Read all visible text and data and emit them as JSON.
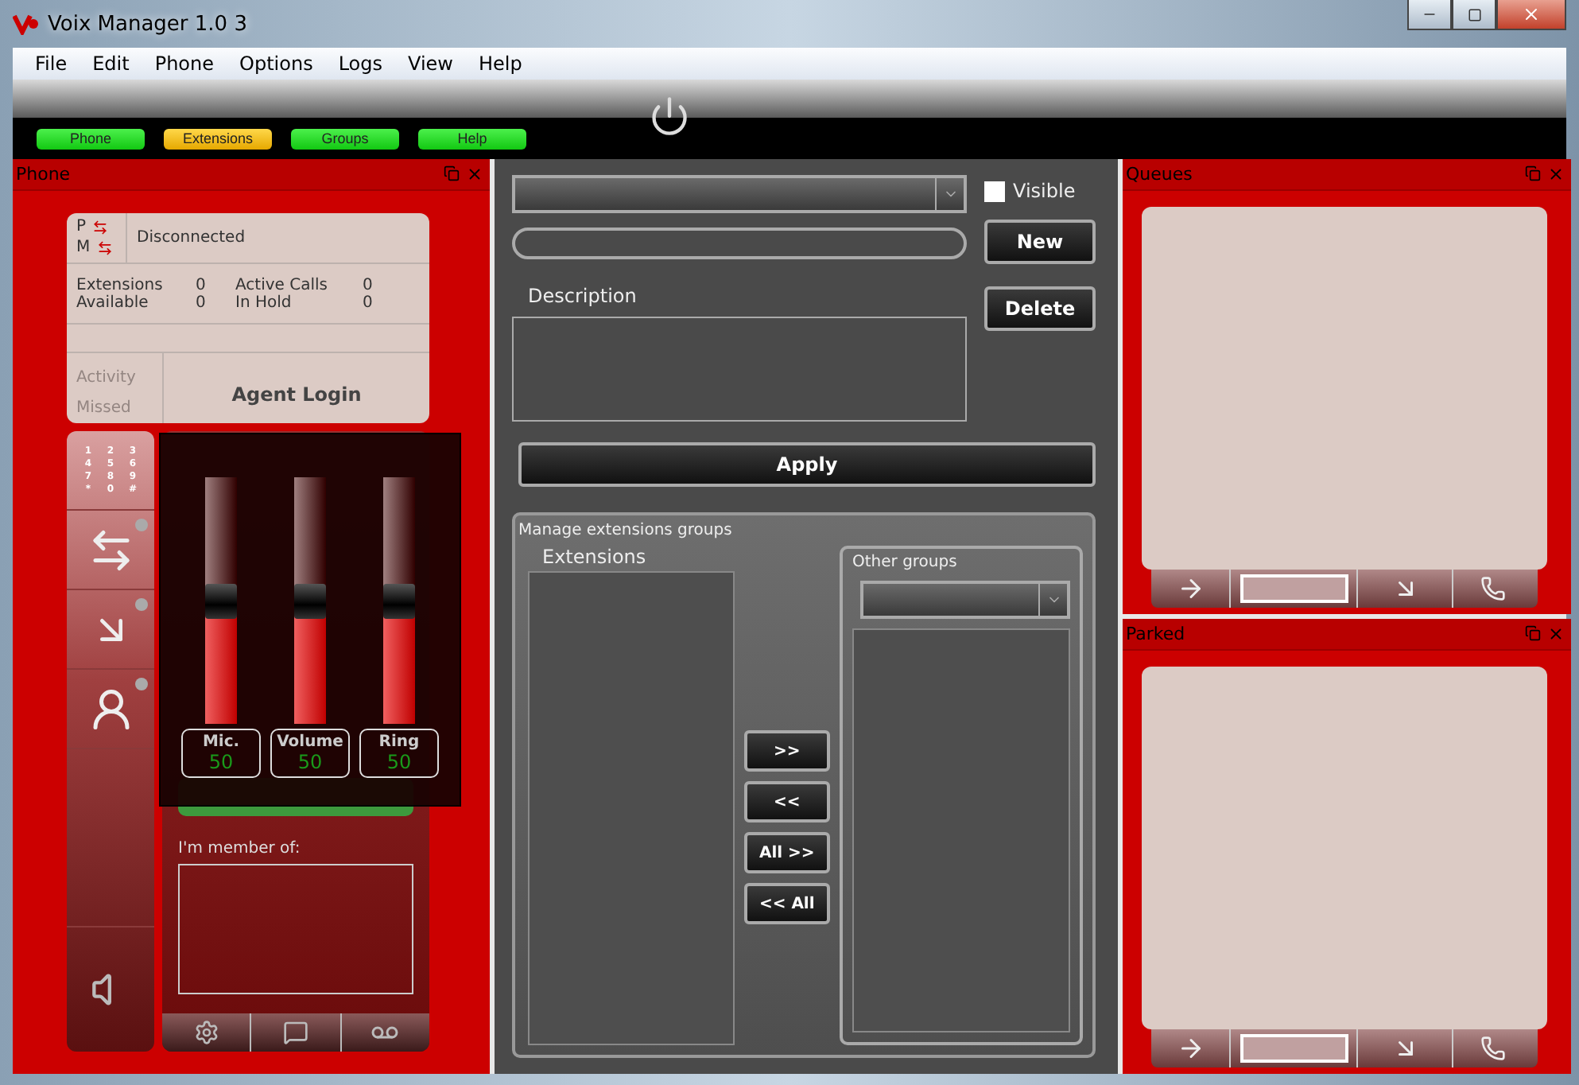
{
  "window": {
    "title": "Voix Manager 1.0 3"
  },
  "menu": [
    "File",
    "Edit",
    "Phone",
    "Options",
    "Logs",
    "View",
    "Help"
  ],
  "nav_tabs": [
    {
      "label": "Phone",
      "selected": false
    },
    {
      "label": "Extensions",
      "selected": true
    },
    {
      "label": "Groups",
      "selected": false
    },
    {
      "label": "Help",
      "selected": false
    }
  ],
  "phone_panel": {
    "title": "Phone",
    "lines": [
      "P",
      "M"
    ],
    "status": "Disconnected",
    "stats": [
      {
        "label": "Extensions",
        "value": "0"
      },
      {
        "label": "Active Calls",
        "value": "0"
      },
      {
        "label": "Available",
        "value": "0"
      },
      {
        "label": "In Hold",
        "value": "0"
      }
    ],
    "activity": {
      "text": "Activity Missed",
      "disabled": true
    },
    "agent_login": "Agent Login",
    "keypad": [
      "1",
      "2",
      "3",
      "4",
      "5",
      "6",
      "7",
      "8",
      "9",
      "*",
      "0",
      "#"
    ],
    "member_label": "I'm member of:",
    "mixer": [
      {
        "label": "Mic.",
        "reading": "50",
        "level": 0.5
      },
      {
        "label": "Volume",
        "reading": "50",
        "level": 0.5
      },
      {
        "label": "Ring",
        "reading": "50",
        "level": 0.5
      }
    ]
  },
  "extensions": {
    "visible": {
      "label": "Visible",
      "checked": false
    },
    "new_button": "New",
    "delete_button": "Delete",
    "description_label": "Description",
    "apply_button": "Apply",
    "groups": {
      "title": "Manage extensions groups",
      "extensions_label": "Extensions",
      "other_label": "Other groups",
      "move_buttons": [
        ">>",
        "<<",
        "All >>",
        "<< All"
      ]
    }
  },
  "queues": {
    "title": "Queues"
  },
  "parked": {
    "title": "Parked"
  }
}
